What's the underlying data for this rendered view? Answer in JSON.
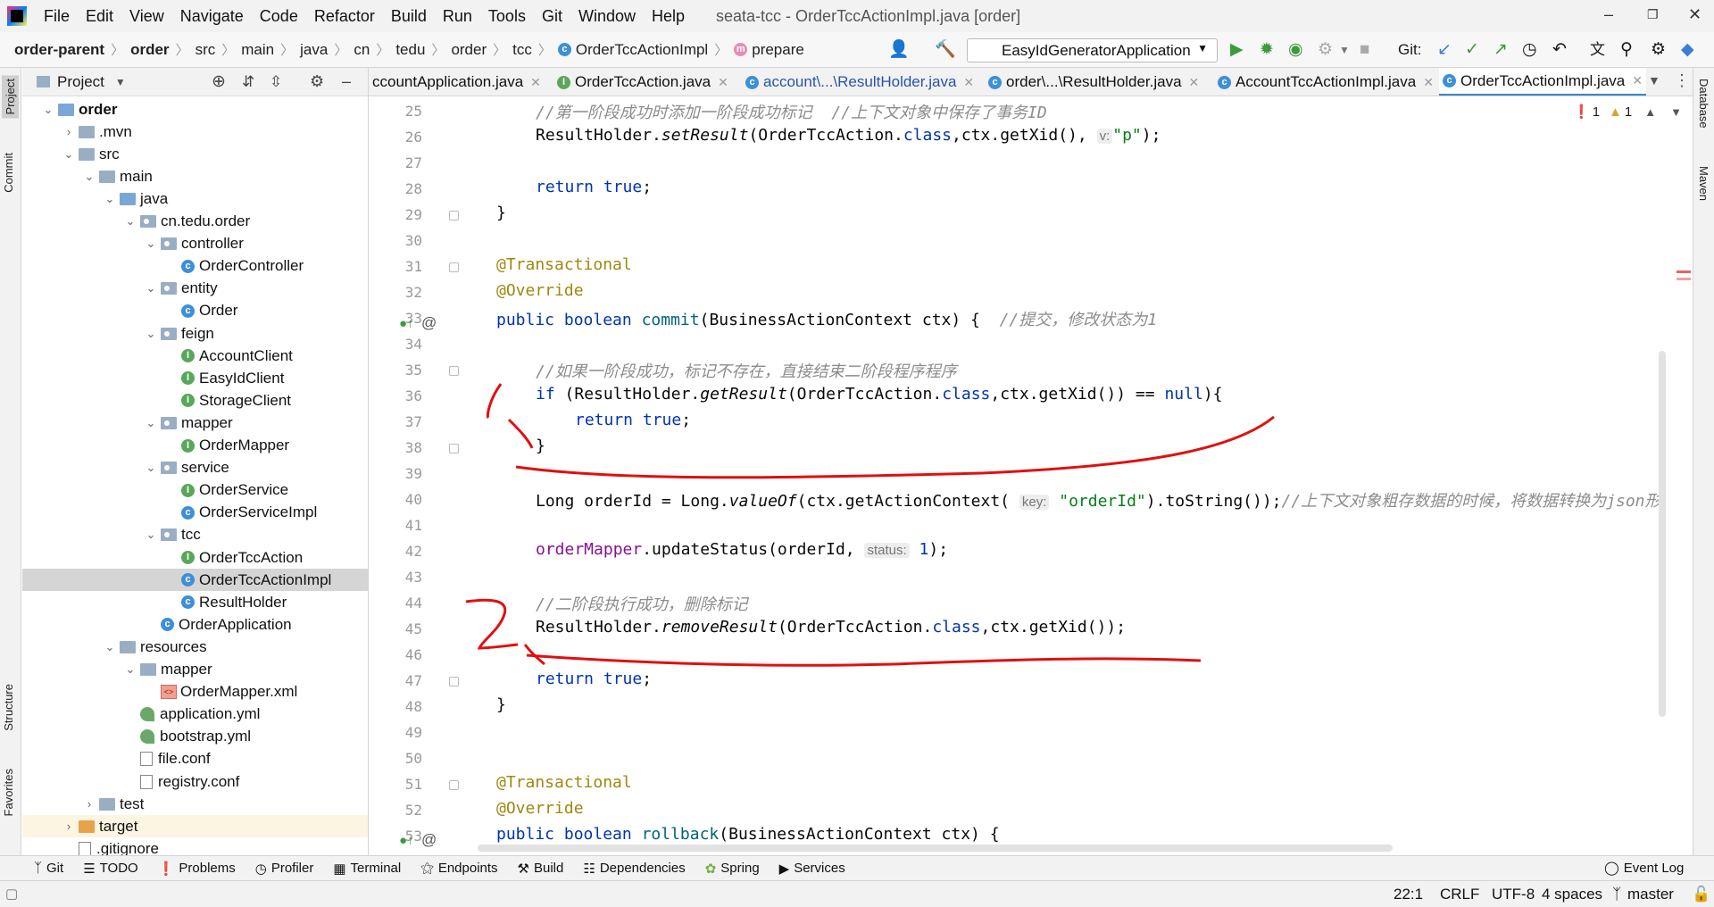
{
  "menubar": {
    "items": [
      "File",
      "Edit",
      "View",
      "Navigate",
      "Code",
      "Refactor",
      "Build",
      "Run",
      "Tools",
      "Git",
      "Window",
      "Help"
    ],
    "title": "seata-tcc - OrderTccActionImpl.java [order]"
  },
  "breadcrumb": [
    "order-parent",
    "order",
    "src",
    "main",
    "java",
    "cn",
    "tedu",
    "order",
    "tcc",
    "OrderTccActionImpl",
    "prepare"
  ],
  "toolbar": {
    "run_config": "EasyIdGeneratorApplication",
    "git_label": "Git:"
  },
  "project_panel": {
    "title": "Project",
    "tree": [
      {
        "label": "order",
        "indent": 0,
        "arrow": "down",
        "icon": "module-folder",
        "bold": true
      },
      {
        "label": ".mvn",
        "indent": 1,
        "arrow": "right",
        "icon": "folder"
      },
      {
        "label": "src",
        "indent": 1,
        "arrow": "down",
        "icon": "folder"
      },
      {
        "label": "main",
        "indent": 2,
        "arrow": "down",
        "icon": "folder"
      },
      {
        "label": "java",
        "indent": 3,
        "arrow": "down",
        "icon": "source-folder"
      },
      {
        "label": "cn.tedu.order",
        "indent": 4,
        "arrow": "down",
        "icon": "package"
      },
      {
        "label": "controller",
        "indent": 5,
        "arrow": "down",
        "icon": "package"
      },
      {
        "label": "OrderController",
        "indent": 6,
        "arrow": "",
        "icon": "class"
      },
      {
        "label": "entity",
        "indent": 5,
        "arrow": "down",
        "icon": "package"
      },
      {
        "label": "Order",
        "indent": 6,
        "arrow": "",
        "icon": "class"
      },
      {
        "label": "feign",
        "indent": 5,
        "arrow": "down",
        "icon": "package"
      },
      {
        "label": "AccountClient",
        "indent": 6,
        "arrow": "",
        "icon": "interface"
      },
      {
        "label": "EasyIdClient",
        "indent": 6,
        "arrow": "",
        "icon": "interface"
      },
      {
        "label": "StorageClient",
        "indent": 6,
        "arrow": "",
        "icon": "interface"
      },
      {
        "label": "mapper",
        "indent": 5,
        "arrow": "down",
        "icon": "package"
      },
      {
        "label": "OrderMapper",
        "indent": 6,
        "arrow": "",
        "icon": "interface"
      },
      {
        "label": "service",
        "indent": 5,
        "arrow": "down",
        "icon": "package"
      },
      {
        "label": "OrderService",
        "indent": 6,
        "arrow": "",
        "icon": "interface"
      },
      {
        "label": "OrderServiceImpl",
        "indent": 6,
        "arrow": "",
        "icon": "class"
      },
      {
        "label": "tcc",
        "indent": 5,
        "arrow": "down",
        "icon": "package"
      },
      {
        "label": "OrderTccAction",
        "indent": 6,
        "arrow": "",
        "icon": "interface"
      },
      {
        "label": "OrderTccActionImpl",
        "indent": 6,
        "arrow": "",
        "icon": "class",
        "selected": true
      },
      {
        "label": "ResultHolder",
        "indent": 6,
        "arrow": "",
        "icon": "class"
      },
      {
        "label": "OrderApplication",
        "indent": 5,
        "arrow": "",
        "icon": "spring-class"
      },
      {
        "label": "resources",
        "indent": 3,
        "arrow": "down",
        "icon": "resource-folder"
      },
      {
        "label": "mapper",
        "indent": 4,
        "arrow": "down",
        "icon": "folder"
      },
      {
        "label": "OrderMapper.xml",
        "indent": 5,
        "arrow": "",
        "icon": "xml"
      },
      {
        "label": "application.yml",
        "indent": 4,
        "arrow": "",
        "icon": "yml"
      },
      {
        "label": "bootstrap.yml",
        "indent": 4,
        "arrow": "",
        "icon": "yml"
      },
      {
        "label": "file.conf",
        "indent": 4,
        "arrow": "",
        "icon": "file"
      },
      {
        "label": "registry.conf",
        "indent": 4,
        "arrow": "",
        "icon": "file"
      },
      {
        "label": "test",
        "indent": 2,
        "arrow": "right",
        "icon": "folder"
      },
      {
        "label": "target",
        "indent": 1,
        "arrow": "right",
        "icon": "excluded-folder",
        "highlight": true
      },
      {
        "label": ".gitignore",
        "indent": 1,
        "arrow": "",
        "icon": "file"
      }
    ]
  },
  "tabs": [
    {
      "label": "ccountApplication.java",
      "icon": "",
      "blue": false
    },
    {
      "label": "OrderTccAction.java",
      "icon": "interface",
      "blue": false
    },
    {
      "label": "account\\...\\ResultHolder.java",
      "icon": "class",
      "blue": true
    },
    {
      "label": "order\\...\\ResultHolder.java",
      "icon": "class",
      "blue": false
    },
    {
      "label": "AccountTccActionImpl.java",
      "icon": "class",
      "blue": false
    },
    {
      "label": "OrderTccActionImpl.java",
      "icon": "class",
      "blue": false,
      "active": true
    }
  ],
  "inspection": {
    "errors": "1",
    "warnings": "1"
  },
  "code": {
    "line_numbers": [
      "25",
      "26",
      "27",
      "28",
      "29",
      "30",
      "31",
      "32",
      "33",
      "34",
      "35",
      "36",
      "37",
      "38",
      "39",
      "40",
      "41",
      "42",
      "43",
      "44",
      "45",
      "46",
      "47",
      "48",
      "49",
      "50",
      "51",
      "52",
      "53"
    ],
    "c25": "//第一阶段成功时添加一阶段成功标记  //上下文对象中保存了事务ID",
    "c26a": "ResultHolder.",
    "c26b": "setResult",
    "c26c": "(OrderTccAction.",
    "c26d": "class",
    "c26e": ",ctx.getXid(),",
    "c26hint": "v:",
    "c26f": "\"p\"",
    "c26g": ");",
    "c28a": "return",
    "c28b": "true",
    "c28c": ";",
    "c29": "}",
    "c31": "@Transactional",
    "c32": "@Override",
    "c33a": "public",
    "c33b": "boolean",
    "c33c": "commit",
    "c33d": "(BusinessActionContext ctx) {  ",
    "c33e": "//提交，修改状态为1",
    "c35": "//如果一阶段成功，标记不存在，直接结束二阶段程序程序",
    "c36a": "if",
    "c36b": " (ResultHolder.",
    "c36c": "getResult",
    "c36d": "(OrderTccAction.",
    "c36e": "class",
    "c36f": ",ctx.getXid()) == ",
    "c36g": "null",
    "c36h": "){",
    "c37a": "return",
    "c37b": "true",
    "c37c": ";",
    "c38": "}",
    "c40a": "Long orderId = Long.",
    "c40b": "valueOf",
    "c40c": "(ctx.getActionContext(",
    "c40hint": "key:",
    "c40d": "\"orderId\"",
    "c40e": ").toString());",
    "c40f": "//上下文对象粗存数据的时候，将数据转换为json形",
    "c42a": "orderMapper",
    "c42b": ".updateStatus(orderId,",
    "c42hint": "status:",
    "c42c": "1",
    "c42d": ");",
    "c44": "//二阶段执行成功，删除标记",
    "c45a": "ResultHolder.",
    "c45b": "removeResult",
    "c45c": "(OrderTccAction.",
    "c45d": "class",
    "c45e": ",ctx.getXid());",
    "c47a": "return",
    "c47b": "true",
    "c47c": ";",
    "c48": "}",
    "c51": "@Transactional",
    "c52": "@Override",
    "c53a": "public",
    "c53b": "boolean",
    "c53c": "rollback",
    "c53d": "(BusinessActionContext ctx) {"
  },
  "left_strip": [
    "Project",
    "Commit",
    "Structure",
    "Favorites"
  ],
  "right_strip": [
    "Database",
    "Maven"
  ],
  "bottom_tools": [
    "Git",
    "TODO",
    "Problems",
    "Profiler",
    "Terminal",
    "Endpoints",
    "Build",
    "Dependencies",
    "Spring",
    "Services"
  ],
  "event_log": "Event Log",
  "status": {
    "position": "22:1",
    "line_sep": "CRLF",
    "encoding": "UTF-8",
    "indent": "4 spaces",
    "branch": "master"
  }
}
